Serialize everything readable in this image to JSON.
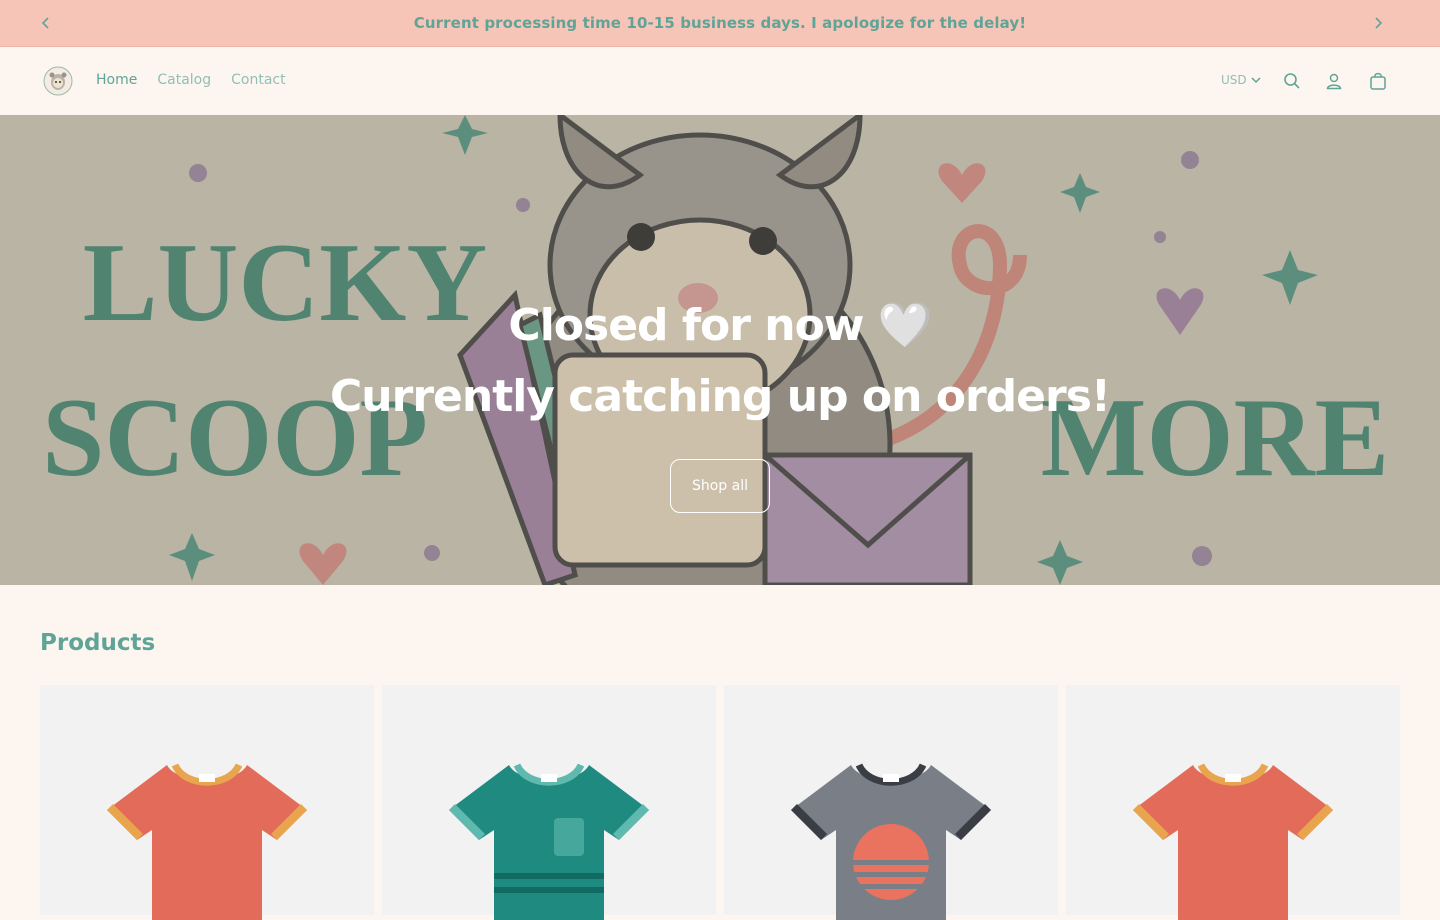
{
  "announcement": {
    "text": "Current processing time 10-15 business days. I apologize for the delay!",
    "prev_icon": "chevron-left-icon",
    "next_icon": "chevron-right-icon"
  },
  "header": {
    "logo_icon": "opossum-logo-icon",
    "nav": [
      {
        "label": "Home",
        "active": true
      },
      {
        "label": "Catalog",
        "active": false
      },
      {
        "label": "Contact",
        "active": false
      }
    ],
    "currency": "USD",
    "icons": [
      "search-icon",
      "account-icon",
      "cart-icon"
    ]
  },
  "hero": {
    "banner_words": [
      "LUCKY",
      "SCOOP",
      "MORE"
    ],
    "title_line1": "Closed for now 🤍",
    "title_line2": "Currently catching up on orders!",
    "button_label": "Shop all"
  },
  "products": {
    "heading": "Products",
    "items": [
      {
        "image": "red-tshirt"
      },
      {
        "image": "teal-tshirt-with-pocket"
      },
      {
        "image": "gray-tshirt-sunset-graphic"
      },
      {
        "image": "red-tshirt"
      }
    ]
  },
  "colors": {
    "announcement_bg": "#f7c4b8",
    "accent": "#5fa497",
    "page_bg": "#fdf6f0"
  }
}
